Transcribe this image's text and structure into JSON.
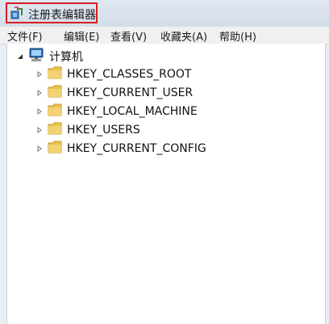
{
  "window": {
    "title": "注册表编辑器"
  },
  "menu": [
    {
      "label": "文件(F)"
    },
    {
      "label": "编辑(E)"
    },
    {
      "label": "查看(V)"
    },
    {
      "label": "收藏夹(A)"
    },
    {
      "label": "帮助(H)"
    }
  ],
  "tree": {
    "root": {
      "label": "计算机",
      "icon": "computer-icon"
    },
    "children": [
      {
        "label": "HKEY_CLASSES_ROOT",
        "icon": "folder-icon"
      },
      {
        "label": "HKEY_CURRENT_USER",
        "icon": "folder-icon"
      },
      {
        "label": "HKEY_LOCAL_MACHINE",
        "icon": "folder-icon"
      },
      {
        "label": "HKEY_USERS",
        "icon": "folder-icon"
      },
      {
        "label": "HKEY_CURRENT_CONFIG",
        "icon": "folder-icon"
      }
    ]
  },
  "colors": {
    "highlight_border": "#d81e1e",
    "folder": "#e9c24f"
  }
}
